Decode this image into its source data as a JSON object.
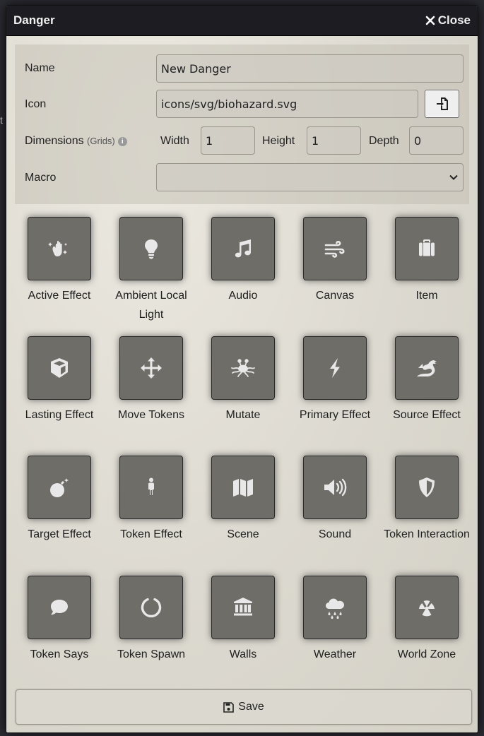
{
  "window": {
    "title": "Danger",
    "close_label": "Close"
  },
  "form": {
    "name_label": "Name",
    "name_value": "New Danger",
    "icon_label": "Icon",
    "icon_value": "icons/svg/biohazard.svg",
    "dimensions_label": "Dimensions",
    "dimensions_unit": "(Grids)",
    "width_label": "Width",
    "width_value": "1",
    "height_label": "Height",
    "height_value": "1",
    "depth_label": "Depth",
    "depth_value": "0",
    "macro_label": "Macro",
    "macro_value": ""
  },
  "tiles": [
    {
      "label": "Active Effect",
      "icon": "hand-sparkles-icon"
    },
    {
      "label": "Ambient Local Light",
      "icon": "lightbulb-icon"
    },
    {
      "label": "Audio",
      "icon": "music-icon"
    },
    {
      "label": "Canvas",
      "icon": "wind-icon"
    },
    {
      "label": "Item",
      "icon": "suitcase-icon"
    },
    {
      "label": "Lasting Effect",
      "icon": "cube-icon"
    },
    {
      "label": "Move Tokens",
      "icon": "arrows-move-icon"
    },
    {
      "label": "Mutate",
      "icon": "spaghetti-monster-icon"
    },
    {
      "label": "Primary Effect",
      "icon": "bolt-icon"
    },
    {
      "label": "Source Effect",
      "icon": "dragon-icon"
    },
    {
      "label": "Target Effect",
      "icon": "bomb-icon"
    },
    {
      "label": "Token Effect",
      "icon": "person-icon"
    },
    {
      "label": "Scene",
      "icon": "map-icon"
    },
    {
      "label": "Sound",
      "icon": "volume-icon"
    },
    {
      "label": "Token Interaction",
      "icon": "shield-icon"
    },
    {
      "label": "Token Says",
      "icon": "comment-icon"
    },
    {
      "label": "Token Spawn",
      "icon": "circle-notch-icon"
    },
    {
      "label": "Walls",
      "icon": "landmark-icon"
    },
    {
      "label": "Weather",
      "icon": "cloud-rain-icon"
    },
    {
      "label": "World Zone",
      "icon": "radiation-icon"
    }
  ],
  "save_label": "Save"
}
